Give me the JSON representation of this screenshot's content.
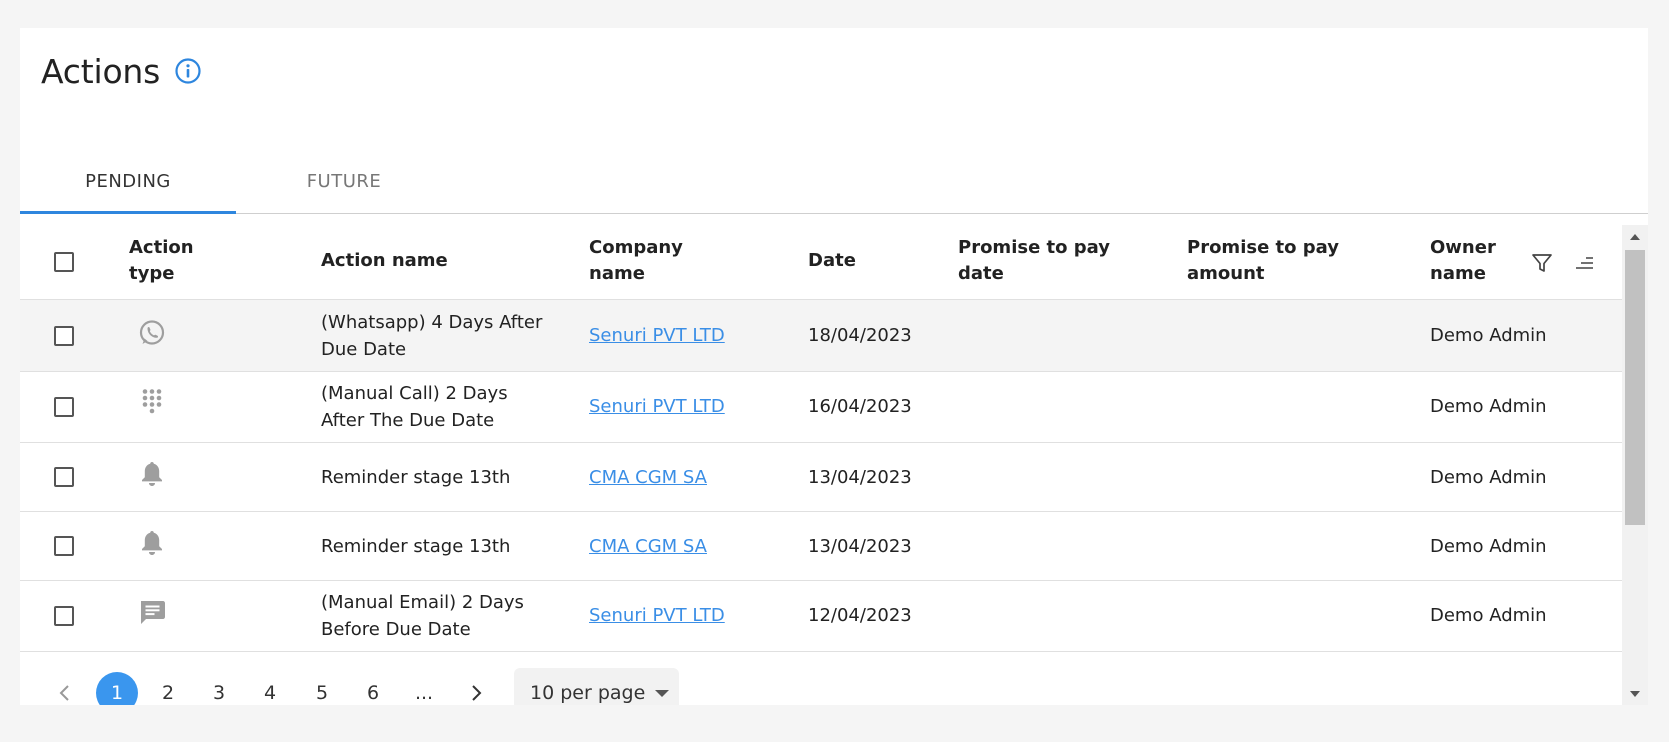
{
  "page": {
    "title": "Actions"
  },
  "tabs": [
    {
      "label": "PENDING",
      "active": true
    },
    {
      "label": "FUTURE",
      "active": false
    }
  ],
  "table": {
    "columns": {
      "action_type": [
        "Action",
        "type"
      ],
      "action_name": "Action name",
      "company_name": [
        "Company",
        "name"
      ],
      "date": "Date",
      "ptp_date": [
        "Promise to pay",
        "date"
      ],
      "ptp_amount": [
        "Promise to pay",
        "amount"
      ],
      "owner_name": [
        "Owner",
        "name"
      ]
    },
    "rows": [
      {
        "icon": "whatsapp-icon",
        "name": [
          "(Whatsapp) 4 Days After",
          "Due Date"
        ],
        "company": "Senuri PVT LTD",
        "date": "18/04/2023",
        "ptp_date": "",
        "ptp_amount": "",
        "owner": "Demo Admin"
      },
      {
        "icon": "dialpad-icon",
        "name": [
          "(Manual Call) 2 Days",
          "After The Due Date"
        ],
        "company": "Senuri PVT LTD",
        "date": "16/04/2023",
        "ptp_date": "",
        "ptp_amount": "",
        "owner": "Demo Admin"
      },
      {
        "icon": "bell-icon",
        "name": [
          "Reminder stage 13th"
        ],
        "company": "CMA CGM SA",
        "date": "13/04/2023",
        "ptp_date": "",
        "ptp_amount": "",
        "owner": "Demo Admin"
      },
      {
        "icon": "bell-icon",
        "name": [
          "Reminder stage 13th"
        ],
        "company": "CMA CGM SA",
        "date": "13/04/2023",
        "ptp_date": "",
        "ptp_amount": "",
        "owner": "Demo Admin"
      },
      {
        "icon": "message-icon",
        "name": [
          "(Manual Email) 2 Days",
          "Before Due Date"
        ],
        "company": "Senuri PVT LTD",
        "date": "12/04/2023",
        "ptp_date": "",
        "ptp_amount": "",
        "owner": "Demo Admin"
      }
    ]
  },
  "pagination": {
    "pages": [
      "1",
      "2",
      "3",
      "4",
      "5",
      "6",
      "..."
    ],
    "current": "1",
    "per_page": "10 per page"
  },
  "colors": {
    "accent": "#2e86de",
    "link": "#3a8ee6",
    "icon_gray": "#9e9e9e"
  }
}
